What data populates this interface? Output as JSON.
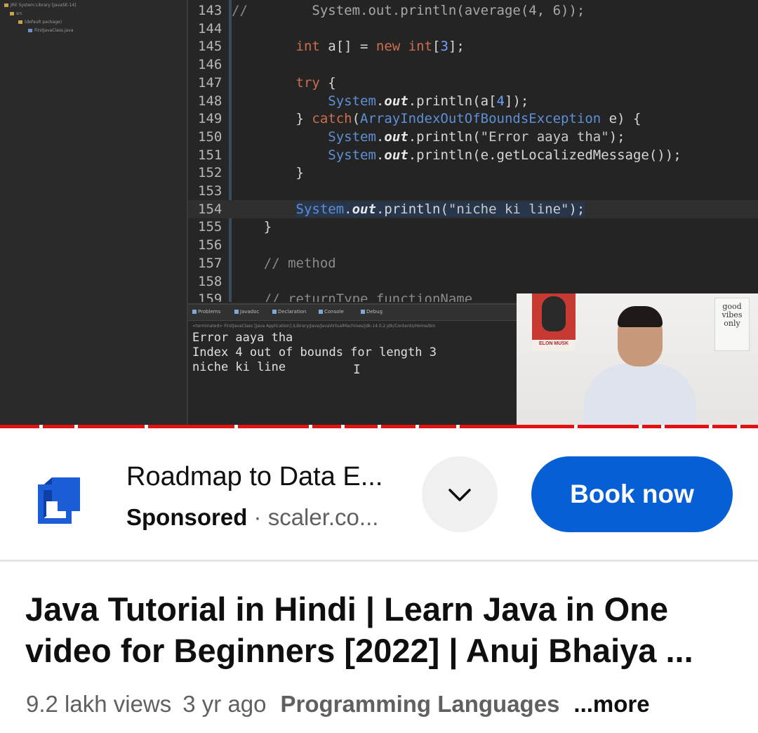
{
  "video": {
    "tree": [
      {
        "text": "JRE System Library [JavaSE-14]"
      },
      {
        "text": "src"
      },
      {
        "text": "(default package)"
      },
      {
        "text": "FirstJavaClass.java"
      }
    ],
    "code_lines": [
      {
        "n": "143",
        "text": "//        System.out.println(average(4, 6));"
      },
      {
        "n": "144",
        "text": ""
      },
      {
        "n": "145",
        "text": "        int a[] = new int[3];"
      },
      {
        "n": "146",
        "text": ""
      },
      {
        "n": "147",
        "text": "        try {"
      },
      {
        "n": "148",
        "text": "            System.out.println(a[4]);"
      },
      {
        "n": "149",
        "text": "        } catch(ArrayIndexOutOfBoundsException e) {"
      },
      {
        "n": "150",
        "text": "            System.out.println(\"Error aaya tha\");"
      },
      {
        "n": "151",
        "text": "            System.out.println(e.getLocalizedMessage());"
      },
      {
        "n": "152",
        "text": "        }"
      },
      {
        "n": "153",
        "text": ""
      },
      {
        "n": "154",
        "text": "        System.out.println(\"niche ki line\");"
      },
      {
        "n": "155",
        "text": "    }"
      },
      {
        "n": "156",
        "text": ""
      },
      {
        "n": "157",
        "text": "    // method"
      },
      {
        "n": "158",
        "text": ""
      },
      {
        "n": "159",
        "text": "    // returnType functionName"
      }
    ],
    "console_tabs": [
      "Problems",
      "Javadoc",
      "Declaration",
      "Console",
      "Debug"
    ],
    "console_path": "<terminated> FirstJavaClass [Java Application] /Library/Java/JavaVirtualMachines/jdk-14.0.2.jdk/Contents/Home/bin",
    "console_output": [
      "Error aaya tha",
      "Index 4 out of bounds for length 3",
      "niche ki line"
    ],
    "webcam": {
      "poster_caption": "ELON MUSK",
      "note": "good vibes only"
    }
  },
  "ad": {
    "title": "Roadmap to Data E...",
    "sponsored_label": "Sponsored",
    "separator": " · ",
    "domain": "scaler.co...",
    "book_label": "Book now",
    "brand_color": "#065fd4"
  },
  "video_info": {
    "title_line1": "Java Tutorial in Hindi | Learn Java in One",
    "title_line2": "video for Beginners [2022] | Anuj Bhaiya ...",
    "views": "9.2 lakh views",
    "age": "3 yr ago",
    "category": "Programming Languages",
    "more": "...more"
  }
}
